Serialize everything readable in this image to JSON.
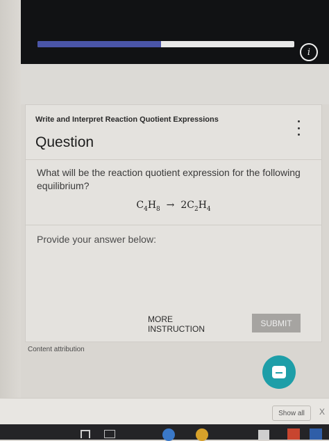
{
  "header": {
    "progress_percent": 48
  },
  "card": {
    "topic_title": "Write and Interpret Reaction Quotient Expressions",
    "heading": "Question",
    "question_text": "What will be the reaction quotient expression for the following equilibrium?",
    "equation": {
      "reactant_base": "C",
      "reactant_sub1": "4",
      "reactant_h": "H",
      "reactant_sub2": "8",
      "arrow": "→",
      "product_coef": "2",
      "product_base": "C",
      "product_sub1": "2",
      "product_h": "H",
      "product_sub2": "4"
    },
    "answer_prompt": "Provide your answer below:",
    "more_instruction_label": "MORE INSTRUCTION",
    "submit_label": "SUBMIT"
  },
  "footer": {
    "attribution": "Content attribution"
  },
  "download_bar": {
    "show_all_label": "Show all",
    "close_glyph": "X"
  },
  "colors": {
    "progress_fill": "#4a55a8",
    "chat_button": "#1e9ea8",
    "topbar": "#111214"
  }
}
